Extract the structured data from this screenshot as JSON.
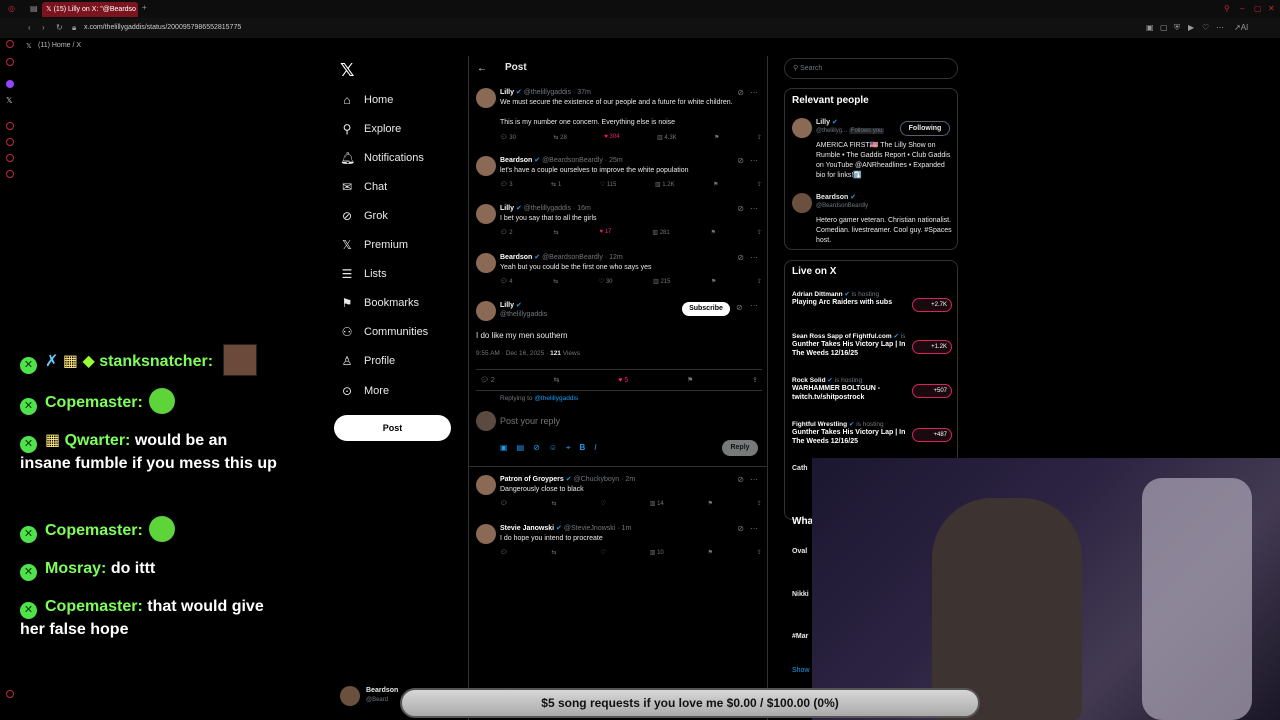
{
  "browser": {
    "tab_title": "(15) Lilly on X: \"@Beardso",
    "url": "x.com/thelillygaddis/status/2000957986552815775",
    "bookmark": "(11) Home / X",
    "ext_label": "AI"
  },
  "chat": [
    {
      "user": "stanksnatcher:",
      "msg": ""
    },
    {
      "user": "Copemaster:",
      "msg": ""
    },
    {
      "user": "Qwarter:",
      "msg": "would be an insane fumble if you mess this up"
    },
    {
      "user": "Copemaster:",
      "msg": ""
    },
    {
      "user": "Mosray:",
      "msg": "do ittt"
    },
    {
      "user": "Copemaster:",
      "msg": "that would give her false hope"
    }
  ],
  "nav": {
    "items": [
      {
        "label": "Home",
        "icon": "home-icon"
      },
      {
        "label": "Explore",
        "icon": "search-icon"
      },
      {
        "label": "Notifications",
        "icon": "bell-icon"
      },
      {
        "label": "Chat",
        "icon": "mail-icon"
      },
      {
        "label": "Grok",
        "icon": "grok-icon"
      },
      {
        "label": "Premium",
        "icon": "x-icon"
      },
      {
        "label": "Lists",
        "icon": "list-icon"
      },
      {
        "label": "Bookmarks",
        "icon": "bookmark-icon"
      },
      {
        "label": "Communities",
        "icon": "people-icon"
      },
      {
        "label": "Profile",
        "icon": "person-icon"
      },
      {
        "label": "More",
        "icon": "more-icon"
      }
    ],
    "post_label": "Post"
  },
  "header": {
    "title": "Post"
  },
  "tweets": [
    {
      "name": "Lilly",
      "handle": "@thelillygaddis · 37m",
      "text": "We must secure the existence of our people and a future for white children.",
      "text2": "This is my number one concern. Everything else is noise",
      "replies": "30",
      "reposts": "28",
      "likes": "304",
      "views": "4.3K"
    },
    {
      "name": "Beardson",
      "handle": "@BeardsonBeardly · 25m",
      "text": "let's have a couple ourselves to improve the white population",
      "replies": "3",
      "reposts": "1",
      "likes": "115",
      "views": "1.2K"
    },
    {
      "name": "Lilly",
      "handle": "@thelillygaddis · 16m",
      "text": "I bet you say that to all the girls",
      "replies": "2",
      "reposts": "",
      "likes": "17",
      "views": "281"
    },
    {
      "name": "Beardson",
      "handle": "@BeardsonBeardly · 12m",
      "text": "Yeah but you could be the first one who says yes",
      "replies": "4",
      "reposts": "",
      "likes": "30",
      "views": "215"
    }
  ],
  "main_tweet": {
    "name": "Lilly",
    "handle": "@thelillygaddis",
    "subscribe": "Subscribe",
    "text": "I do like my men southern",
    "time": "9:55 AM · Dec 16, 2025 · ",
    "views": "121",
    "views_label": " Views",
    "replies": "2",
    "likes": "5"
  },
  "reply": {
    "replying_to": "Replying to ",
    "replying_handle": "@thelillygaddis",
    "placeholder": "Post your reply",
    "button": "Reply"
  },
  "replies": [
    {
      "name": "Patron of Groypers",
      "handle": "@Chuckyboyn · 2m",
      "text": "Dangerously close to black",
      "views": "14"
    },
    {
      "name": "Stevie Janowski",
      "handle": "@StevieJnowski · 1m",
      "text": "I do hope you intend to procreate",
      "views": "10"
    }
  ],
  "right": {
    "search_placeholder": "Search",
    "relevant_title": "Relevant people",
    "people": [
      {
        "name": "Lilly",
        "handle": "@thelillyg...",
        "follows": "Follows you",
        "button": "Following",
        "bio": "AMERICA FIRST🇺🇸 The Lilly Show on Rumble • The Gaddis Report • Club Gaddis on YouTube @ANRheadlines • Expanded bio for links!⤵️"
      },
      {
        "name": "Beardson",
        "handle": "@BeardsonBeardly",
        "bio": "Hetero gamer veteran. Christian nationalist. Comedian. livestreamer. Cool guy. #Spaces host."
      }
    ],
    "live_title": "Live on X",
    "live": [
      {
        "host": "Adrian Dittmann",
        "status": "is hosting",
        "title": "Playing Arc Raiders with subs",
        "count": "+2.7K"
      },
      {
        "host": "Sean Ross Sapp of Fightful.com",
        "status": "is hosting",
        "title": "Gunther Takes His Victory Lap | In The Weeds 12/16/25",
        "count": "+1.2K"
      },
      {
        "host": "Rock Solid",
        "status": "is hosting",
        "title": "WARHAMMER BOLTGUN - twitch.tv/shitpostrock",
        "count": "+507"
      },
      {
        "host": "Fightful Wrestling",
        "status": "is hosting",
        "title": "Gunther Takes His Victory Lap | In The Weeds 12/16/25",
        "count": "+487"
      }
    ],
    "whats_title": "Wha",
    "trend_frag": [
      "Oval",
      "Nikki",
      "#Mar",
      "Show"
    ],
    "cath": "Cath"
  },
  "bottom": {
    "song_requests": "$5 song requests if you love me $0.00 / $100.00 (0%)",
    "user_name": "Beardson",
    "user_handle": "@Beard"
  }
}
